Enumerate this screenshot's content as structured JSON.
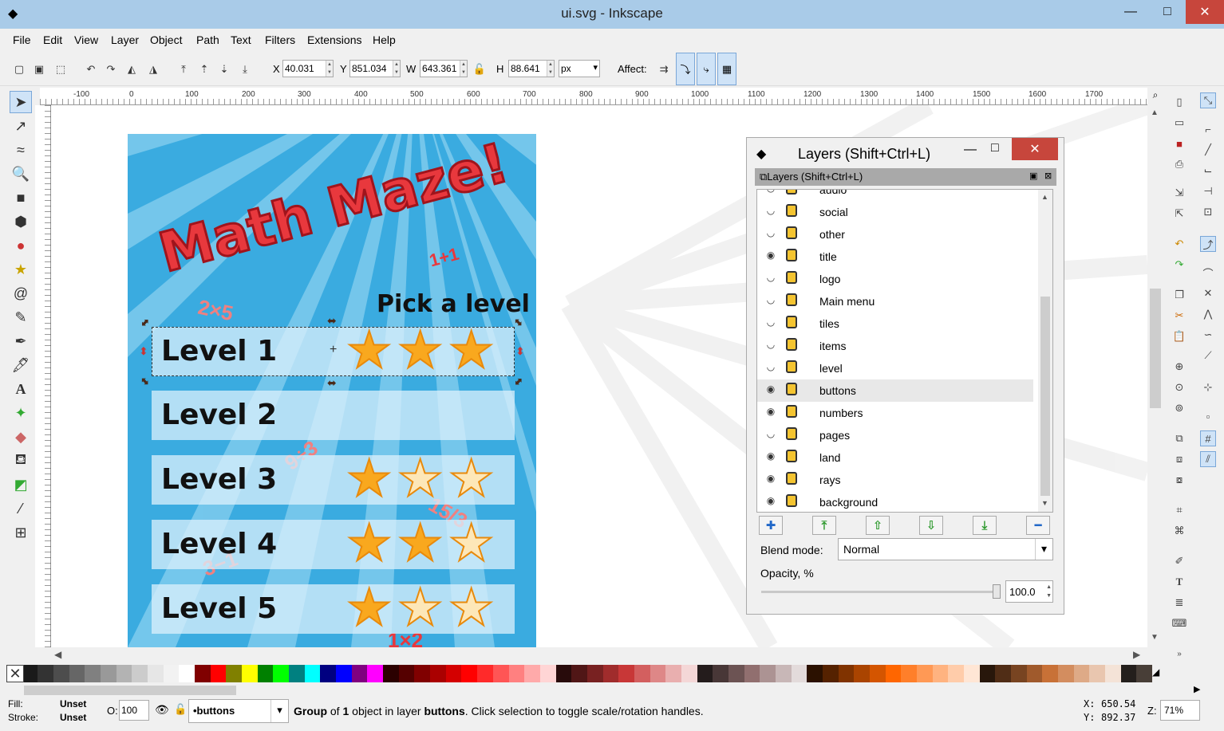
{
  "window": {
    "title": "ui.svg - Inkscape",
    "minimize": "—",
    "maximize": "□",
    "close": "✕"
  },
  "menu": [
    "File",
    "Edit",
    "View",
    "Layer",
    "Object",
    "Path",
    "Text",
    "Filters",
    "Extensions",
    "Help"
  ],
  "toolbar": {
    "x_label": "X",
    "x_value": "40.031",
    "y_label": "Y",
    "y_value": "851.034",
    "w_label": "W",
    "w_value": "643.361",
    "h_label": "H",
    "h_value": "88.641",
    "unit": "px",
    "affect_label": "Affect:"
  },
  "ruler_ticks": [
    "-100",
    "0",
    "100",
    "200",
    "300",
    "400",
    "500",
    "600",
    "700",
    "800",
    "900",
    "1000",
    "1100",
    "1200",
    "1300",
    "1400",
    "1500",
    "1600",
    "1700"
  ],
  "artwork": {
    "title": "Math Maze!",
    "subtitle": "Pick a level",
    "levels": [
      {
        "label": "Level 1",
        "stars": 3
      },
      {
        "label": "Level 2",
        "stars": 0
      },
      {
        "label": "Level 3",
        "stars": 1
      },
      {
        "label": "Level 4",
        "stars": 2
      },
      {
        "label": "Level 5",
        "stars": 1
      }
    ],
    "doodles": [
      "1+1",
      "2×5",
      "9÷3",
      "15/3",
      "3−1",
      "1×2"
    ]
  },
  "layers_panel": {
    "title": "Layers (Shift+Ctrl+L)",
    "tab_title": "Layers (Shift+Ctrl+L)",
    "layers": [
      {
        "name": "audio",
        "visible": false,
        "selected": false
      },
      {
        "name": "social",
        "visible": false,
        "selected": false
      },
      {
        "name": "other",
        "visible": false,
        "selected": false
      },
      {
        "name": "title",
        "visible": true,
        "selected": false
      },
      {
        "name": "logo",
        "visible": false,
        "selected": false
      },
      {
        "name": "Main menu",
        "visible": false,
        "selected": false
      },
      {
        "name": "tiles",
        "visible": false,
        "selected": false
      },
      {
        "name": "items",
        "visible": false,
        "selected": false
      },
      {
        "name": "level",
        "visible": false,
        "selected": false
      },
      {
        "name": "buttons",
        "visible": true,
        "selected": true
      },
      {
        "name": "numbers",
        "visible": true,
        "selected": false
      },
      {
        "name": "pages",
        "visible": false,
        "selected": false
      },
      {
        "name": "land",
        "visible": true,
        "selected": false
      },
      {
        "name": "rays",
        "visible": true,
        "selected": false
      },
      {
        "name": "background",
        "visible": true,
        "selected": false
      }
    ],
    "blend_label": "Blend mode:",
    "blend_value": "Normal",
    "opacity_label": "Opacity, %",
    "opacity_value": "100.0"
  },
  "palette": [
    "#ffffff",
    "#1a1a1a",
    "#333333",
    "#4d4d4d",
    "#666666",
    "#808080",
    "#999999",
    "#b3b3b3",
    "#cccccc",
    "#e6e6e6",
    "#f2f2f2",
    "#ffffff",
    "#800000",
    "#ff0000",
    "#808000",
    "#ffff00",
    "#008000",
    "#00ff00",
    "#008080",
    "#00ffff",
    "#000080",
    "#0000ff",
    "#800080",
    "#ff00ff",
    "#2b0000",
    "#550000",
    "#800000",
    "#aa0000",
    "#d40000",
    "#ff0000",
    "#ff2a2a",
    "#ff5555",
    "#ff8080",
    "#ffaaaa",
    "#ffd5d5",
    "#280b0b",
    "#501616",
    "#782121",
    "#a02c2c",
    "#c83737",
    "#d35f5f",
    "#de8787",
    "#e9afaf",
    "#f4d7d7",
    "#241c1c",
    "#483737",
    "#6c5353",
    "#916f6f",
    "#ac9393",
    "#c8b7b7",
    "#e3dbdb",
    "#2b1100",
    "#552200",
    "#803300",
    "#aa4400",
    "#d45500",
    "#ff6600",
    "#ff7f2a",
    "#ff9955",
    "#ffb380",
    "#ffccaa",
    "#ffe6d5",
    "#28170b",
    "#502d16",
    "#784421",
    "#a05a2c",
    "#c87137",
    "#d38d5f",
    "#deaa87",
    "#e9c6af",
    "#f4e3d7",
    "#241f1c",
    "#483e37"
  ],
  "status": {
    "fill_label": "Fill:",
    "fill_value": "Unset",
    "stroke_label": "Stroke:",
    "stroke_value": "Unset",
    "opacity_label": "O:",
    "opacity_value": "100",
    "layer_value": "•buttons",
    "msg_bold1": "Group",
    "msg_part1": " of ",
    "msg_bold2": "1",
    "msg_part2": " object in layer ",
    "msg_bold3": "buttons",
    "msg_part3": ". Click selection to toggle scale/rotation handles.",
    "x_label": "X:",
    "x_value": "650.54",
    "y_label": "Y:",
    "y_value": "892.37",
    "zoom_label": "Z:",
    "zoom_value": "71%"
  }
}
